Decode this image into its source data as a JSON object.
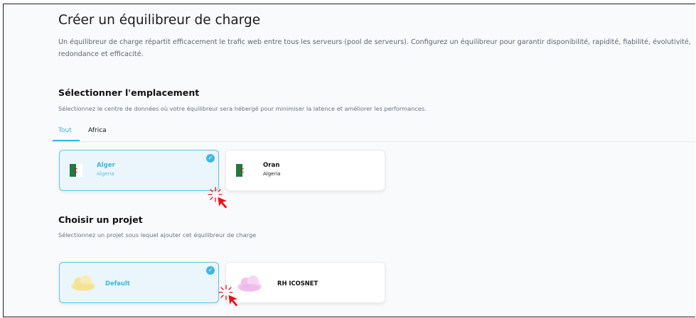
{
  "page": {
    "title": "Créer un équilibreur de charge",
    "description": "Un équilibreur de charge répartit efficacement le trafic web entre tous les serveurs (pool de serveurs). Configurez un équilibreur pour garantir disponibilité, rapidité, fiabilité, évolutivité, redondance et efficacité."
  },
  "location": {
    "heading": "Sélectionner l'emplacement",
    "subtitle": "Sélectionnez le centre de données où votre équilibreur sera hébergé pour minimiser la latence et améliorer les performances.",
    "tabs": [
      {
        "label": "Tout",
        "active": true
      },
      {
        "label": "Africa",
        "active": false
      }
    ],
    "cards": [
      {
        "name": "Alger",
        "country": "Algeria",
        "selected": true,
        "icon": "algeria-flag-icon"
      },
      {
        "name": "Oran",
        "country": "Algeria",
        "selected": false,
        "icon": "algeria-flag-icon"
      }
    ]
  },
  "project": {
    "heading": "Choisir un projet",
    "subtitle": "Sélectionnez un projet sous lequel ajouter cet équilibreur de charge",
    "cards": [
      {
        "name": "Default",
        "selected": true,
        "icon": "yellow-cloud-icon"
      },
      {
        "name": "RH ICOSNET",
        "selected": false,
        "icon": "pink-cloud-icon"
      }
    ]
  },
  "colors": {
    "accent": "#35b8dc",
    "selected_bg": "#eaf6fb",
    "cursor": "#e8101a"
  }
}
